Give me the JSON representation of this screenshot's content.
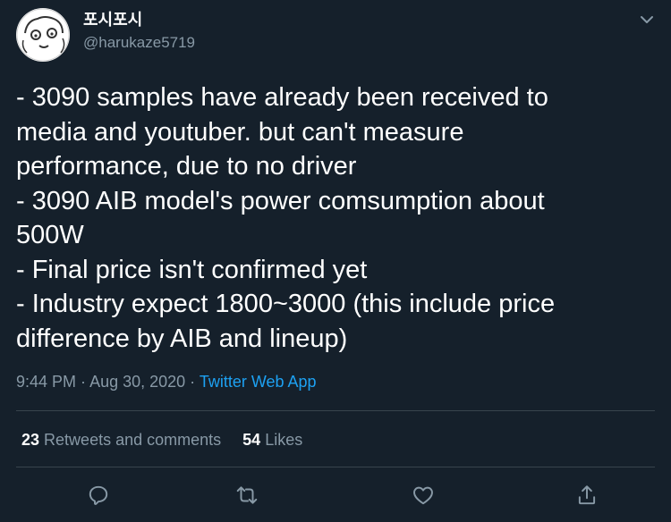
{
  "user": {
    "display_name": "포시포시",
    "handle": "@harukaze5719"
  },
  "tweet": {
    "lines": [
      "- 3090 samples have already been received to",
      "media and youtuber. but can't measure",
      "performance, due to no driver",
      "- 3090 AIB model's power comsumption about",
      "500W",
      "- Final price isn't confirmed yet",
      "- Industry expect 1800~3000 (this include price",
      "difference by AIB and lineup)"
    ],
    "time": "9:44 PM",
    "separator": " · ",
    "date": "Aug 30, 2020",
    "source": "Twitter Web App"
  },
  "stats": {
    "retweets_count": "23",
    "retweets_label": "Retweets and comments",
    "likes_count": "54",
    "likes_label": "Likes"
  },
  "icons": {
    "caret": "chevron-down-icon",
    "reply": "reply-icon",
    "retweet": "retweet-icon",
    "like": "heart-icon",
    "share": "share-icon"
  },
  "colors": {
    "background": "#15202b",
    "text": "#ffffff",
    "secondary": "#8899a6",
    "link": "#1da1f2",
    "divider": "#38444d"
  }
}
